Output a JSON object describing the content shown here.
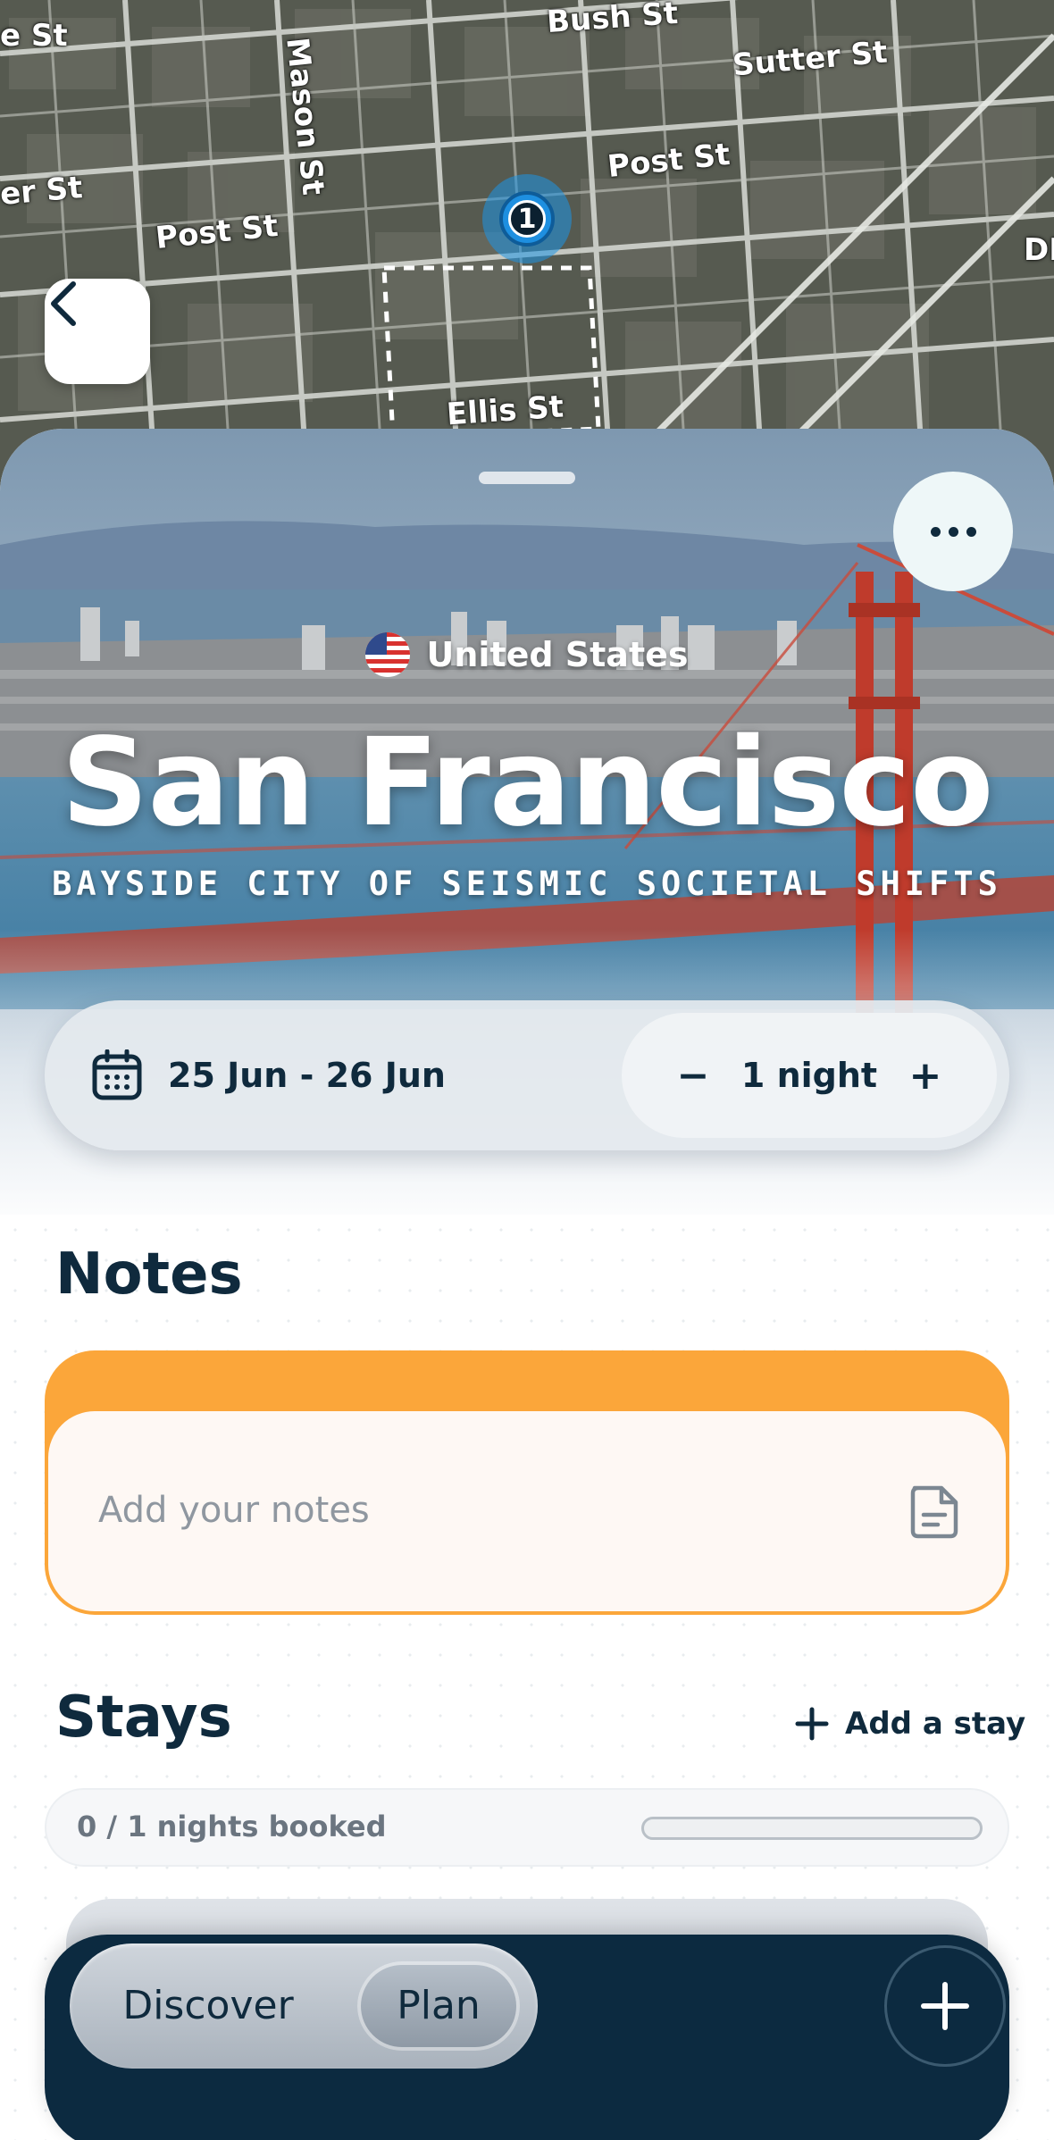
{
  "map": {
    "streets": [
      "e St",
      "Bush St",
      "Mason St",
      "Sutter St",
      "er St",
      "Post St",
      "Post St",
      "Ellis St",
      "DI"
    ],
    "pin_number": "1"
  },
  "header": {
    "country": "United States",
    "city": "San Francisco",
    "tagline": "BAYSIDE CITY OF SEISMIC SOCIETAL SHIFTS"
  },
  "dates": {
    "range": "25 Jun - 26 Jun",
    "decrement_label": "−",
    "nights": "1 night",
    "increment_label": "+"
  },
  "notes": {
    "title": "Notes",
    "placeholder": "Add your notes"
  },
  "stays": {
    "title": "Stays",
    "add_label": "Add a stay",
    "booked_text": "0 / 1 nights booked",
    "booked_fraction": 0
  },
  "nav": {
    "tabs": [
      {
        "label": "Discover",
        "active": false
      },
      {
        "label": "Plan",
        "active": true
      }
    ]
  },
  "colors": {
    "accent_orange": "#fba63a",
    "dark_navy": "#0c2a40",
    "map_pin_blue": "#1e8fe0"
  },
  "icons": [
    "chevron-left-icon",
    "more-dots-icon",
    "us-flag-icon",
    "calendar-icon",
    "note-icon",
    "plus-icon"
  ]
}
